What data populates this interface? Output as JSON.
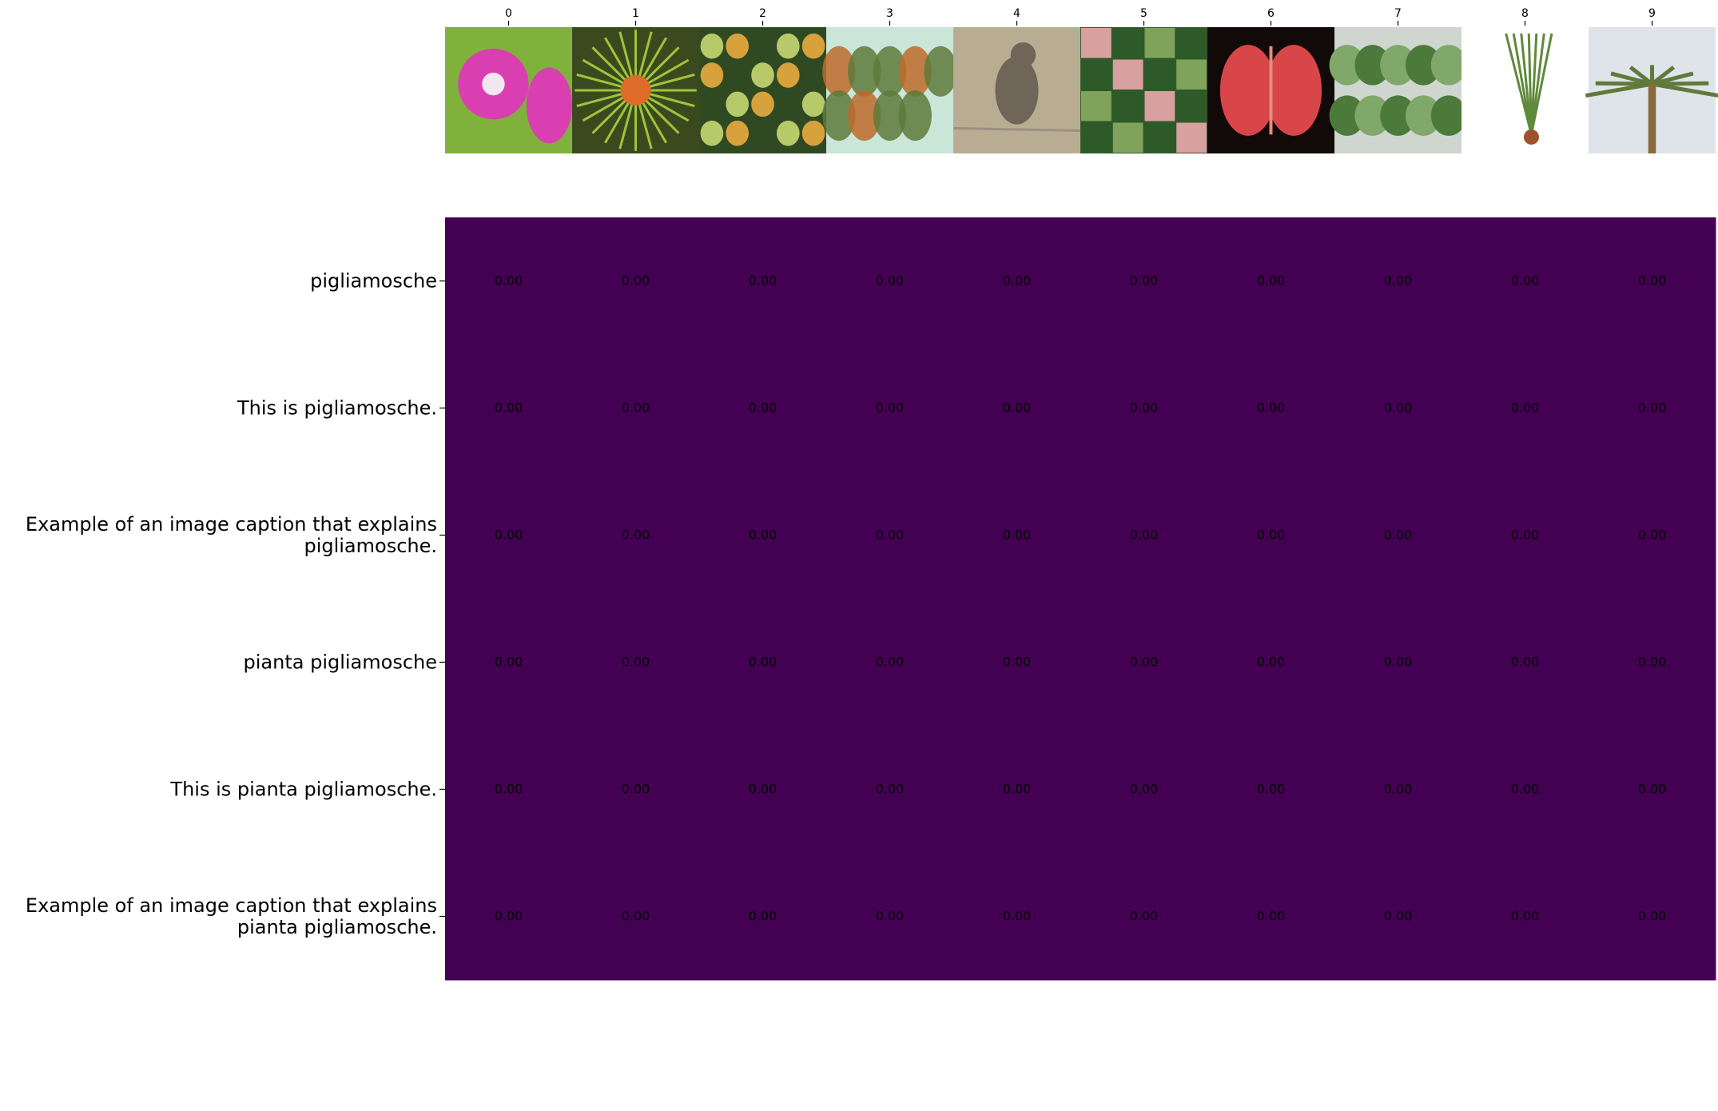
{
  "chart_data": {
    "type": "heatmap",
    "title": "",
    "xlabel": "",
    "ylabel": "",
    "x_tick_labels": [
      "0",
      "1",
      "2",
      "3",
      "4",
      "5",
      "6",
      "7",
      "8",
      "9"
    ],
    "y_tick_labels": [
      "pigliamosche",
      "This is pigliamosche.",
      "Example of an image caption that explains\npigliamosche.",
      "pianta pigliamosche",
      "This is pianta pigliamosche.",
      "Example of an image caption that explains\npianta pigliamosche."
    ],
    "values": [
      [
        0.0,
        0.0,
        0.0,
        0.0,
        0.0,
        0.0,
        0.0,
        0.0,
        0.0,
        0.0
      ],
      [
        0.0,
        0.0,
        0.0,
        0.0,
        0.0,
        0.0,
        0.0,
        0.0,
        0.0,
        0.0
      ],
      [
        0.0,
        0.0,
        0.0,
        0.0,
        0.0,
        0.0,
        0.0,
        0.0,
        0.0,
        0.0
      ],
      [
        0.0,
        0.0,
        0.0,
        0.0,
        0.0,
        0.0,
        0.0,
        0.0,
        0.0,
        0.0
      ],
      [
        0.0,
        0.0,
        0.0,
        0.0,
        0.0,
        0.0,
        0.0,
        0.0,
        0.0,
        0.0
      ],
      [
        0.0,
        0.0,
        0.0,
        0.0,
        0.0,
        0.0,
        0.0,
        0.0,
        0.0,
        0.0
      ]
    ],
    "value_format": "0.00",
    "cell_color": "#440154",
    "annotation_color": "#000000",
    "column_images": [
      {
        "index": 0,
        "subject": "pink morning glory flowers",
        "colors": [
          "#7fb13c",
          "#d93fb0",
          "#f2e6f0"
        ]
      },
      {
        "index": 1,
        "subject": "spiky green and orange plant",
        "colors": [
          "#3b4a1e",
          "#9fc43a",
          "#e06a2a"
        ]
      },
      {
        "index": 2,
        "subject": "vegetable market stall",
        "colors": [
          "#2f4a22",
          "#b8c96a",
          "#d7a13b"
        ]
      },
      {
        "index": 3,
        "subject": "botanical illustration of tropical plants",
        "colors": [
          "#c9e6d9",
          "#5d7a3a",
          "#c06a2c"
        ]
      },
      {
        "index": 4,
        "subject": "grey bird perched on barbed wire",
        "colors": [
          "#b8ad92",
          "#6f6659",
          "#9a9080"
        ]
      },
      {
        "index": 5,
        "subject": "collage of plant photos",
        "colors": [
          "#2e5a2a",
          "#7fa35a",
          "#d9a0a0"
        ]
      },
      {
        "index": 6,
        "subject": "red venus flytrap",
        "colors": [
          "#120a08",
          "#d8464a",
          "#e98b7c"
        ]
      },
      {
        "index": 7,
        "subject": "leafy green shrub",
        "colors": [
          "#cfd6d0",
          "#4c7a3b",
          "#7fa86a"
        ]
      },
      {
        "index": 8,
        "subject": "botanical drawing of grass-like plant",
        "colors": [
          "#ffffff",
          "#5f8a3a",
          "#a0522d"
        ]
      },
      {
        "index": 9,
        "subject": "palm tree against sky",
        "colors": [
          "#dfe4ea",
          "#5f7a3a",
          "#8a6a3a"
        ]
      }
    ]
  }
}
